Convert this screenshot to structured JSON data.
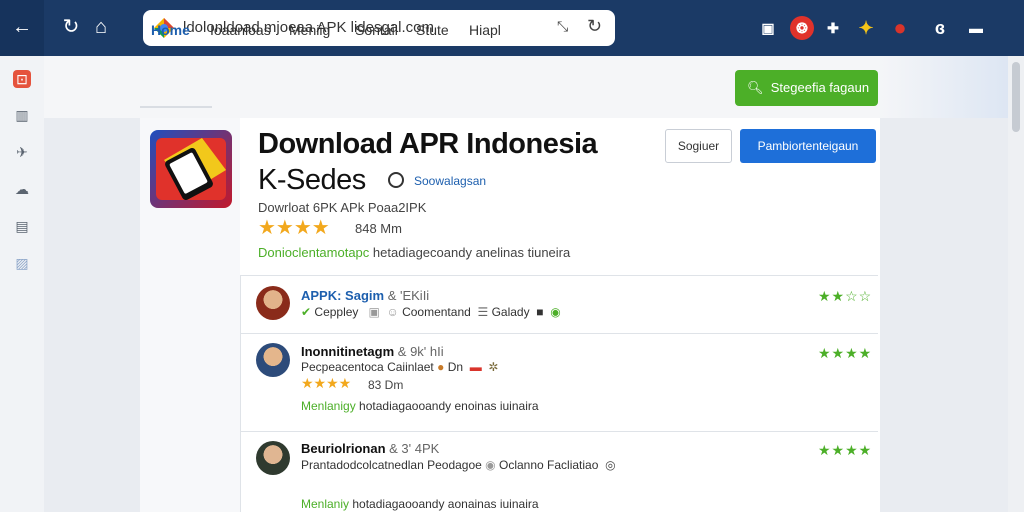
{
  "browser": {
    "url": "ldolonldoad.mjoeaa APK lidesgal.com",
    "extensions": [
      {
        "name": "screen-icon",
        "glyph": "▣",
        "color": "#ffffff",
        "bg": "transparent"
      },
      {
        "name": "app-red-icon",
        "glyph": "❂",
        "color": "#ffffff",
        "bg": "#e0322b"
      },
      {
        "name": "gamepad-icon",
        "glyph": "✚",
        "color": "#ffffff",
        "bg": "transparent"
      },
      {
        "name": "puzzle-icon",
        "glyph": "✦",
        "color": "#f5c518",
        "bg": "transparent"
      },
      {
        "name": "avatar-red-icon",
        "glyph": "●",
        "color": "#d9342b",
        "bg": "transparent"
      },
      {
        "name": "link-icon",
        "glyph": "ɞ",
        "color": "#ffffff",
        "bg": "transparent"
      },
      {
        "name": "chat-icon",
        "glyph": "▬",
        "color": "#ffffff",
        "bg": "transparent"
      }
    ]
  },
  "nav": {
    "tabs": [
      "Home",
      "Ioaanloas",
      "Meniig",
      "Sontail",
      "Stute",
      "Hiapl"
    ],
    "search_label": "Stegeefia fagaun"
  },
  "app": {
    "title_line1": "Download APR Indonesia",
    "title_line2": "K-Sedes",
    "developer": "Soowalagsan",
    "subline": "Dowrloat 6PK APk Poaa2IPK",
    "size": "848 Mm",
    "description_highlight": "Donioclentamotapc",
    "description_rest": "hetadiagecoandy anelinas tiuneira",
    "rating": 3.5,
    "button_secondary": "Sogiuer",
    "button_primary": "Pambiortenteigaun"
  },
  "reviews": [
    {
      "name": "APPK: Sagim",
      "meta": "& 'EKiIi",
      "line1_items": [
        "Ceppley",
        "Coomentand",
        "Galady"
      ],
      "stars": "★★☆☆",
      "name_color": "#1d5fae"
    },
    {
      "name": "Inonnitinetagm",
      "meta": "& 9k' hIi",
      "line1": "Pecpeacentoca Caiinlaet",
      "line1_tail": "Dn",
      "size": "83 Dm",
      "line3_highlight": "Menlanigy",
      "line3_rest": "hotadiagaooandy enoinas iuinaira",
      "stars": "★★★★",
      "name_color": "#111111"
    },
    {
      "name": "Beuriolrionan",
      "meta": "& 3' 4PK",
      "line1": "Prantadodcolcatnedlan Peodagoe",
      "line1_tail": "Oclanno Facliatiao",
      "line3_highlight": "Menlaniy",
      "line3_rest": "hotadiagaooandy aonainas iuinaira",
      "stars": "★★★★",
      "name_color": "#111111"
    }
  ]
}
